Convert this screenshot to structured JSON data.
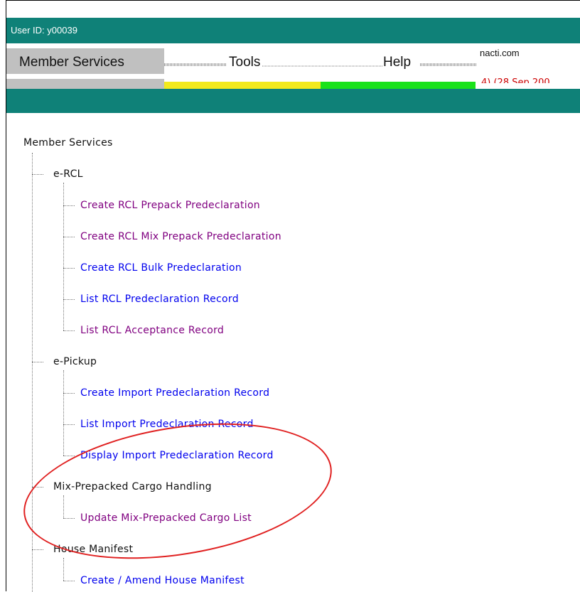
{
  "header": {
    "user_id": "User ID: y00039",
    "domain_text": "nacti.com",
    "date_text": "4) (28 Sep 200"
  },
  "menu": {
    "items": [
      {
        "label": "Member Services"
      },
      {
        "label": "Tools"
      },
      {
        "label": "Help"
      }
    ]
  },
  "tree": {
    "root": "Member Services",
    "groups": [
      {
        "label": "e-RCL",
        "items": [
          {
            "label": "Create RCL Prepack Predeclaration",
            "color": "#800080"
          },
          {
            "label": "Create RCL Mix Prepack Predeclaration",
            "color": "#800080"
          },
          {
            "label": "Create RCL Bulk Predeclaration",
            "color": "#0000ee"
          },
          {
            "label": "List RCL Predeclaration Record",
            "color": "#0000ee"
          },
          {
            "label": "List RCL Acceptance Record",
            "color": "#800080"
          }
        ]
      },
      {
        "label": "e-Pickup",
        "items": [
          {
            "label": "Create Import Predeclaration Record",
            "color": "#0000ee"
          },
          {
            "label": "List Import Predeclaration Record",
            "color": "#0000ee"
          },
          {
            "label": "Display Import Predeclaration Record",
            "color": "#0000ee"
          }
        ]
      },
      {
        "label": "Mix-Prepacked Cargo Handling",
        "items": [
          {
            "label": "Update Mix-Prepacked Cargo List",
            "color": "#800080"
          }
        ]
      },
      {
        "label": "House Manifest",
        "items": [
          {
            "label": "Create / Amend House Manifest",
            "color": "#0000ee"
          }
        ]
      }
    ]
  },
  "annotation": {
    "color": "#e02020"
  }
}
